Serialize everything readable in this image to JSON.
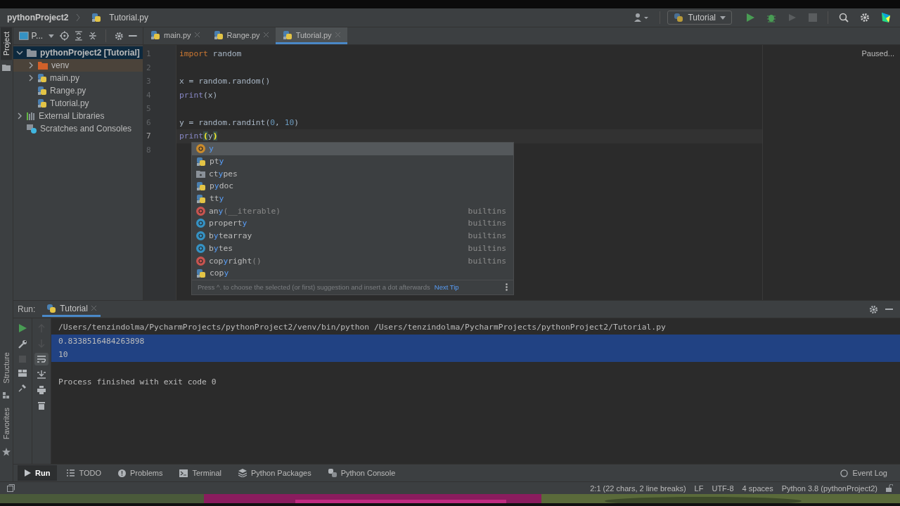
{
  "nav_bar": {
    "breadcrumbs": [
      "pythonProject2",
      "Tutorial.py"
    ],
    "run_config": "Tutorial"
  },
  "project_panel": {
    "tool_label": "Project",
    "view_label": "P...",
    "tree": [
      {
        "label": "pythonProject2 [Tutorial]",
        "kind": "project",
        "expanded": true,
        "selected": true,
        "children": [
          {
            "label": "venv",
            "kind": "excluded-folder",
            "expanded": false,
            "selected": true
          },
          {
            "label": "main.py",
            "kind": "python-file",
            "expanded": false,
            "selected": false
          },
          {
            "label": "Range.py",
            "kind": "python-file",
            "selected": false
          },
          {
            "label": "Tutorial.py",
            "kind": "python-file",
            "selected": false
          }
        ]
      },
      {
        "label": "External Libraries",
        "kind": "libraries",
        "expanded": false,
        "selected": false
      },
      {
        "label": "Scratches and Consoles",
        "kind": "scratches",
        "selected": false
      }
    ]
  },
  "editor_tabs": [
    {
      "label": "main.py",
      "selected": false
    },
    {
      "label": "Range.py",
      "selected": false
    },
    {
      "label": "Tutorial.py",
      "selected": true
    }
  ],
  "editor": {
    "status": "Paused...",
    "lines": [
      {
        "number": "1",
        "current": false,
        "tokens": [
          {
            "text": "import",
            "kind": "keyword"
          },
          {
            "text": " random",
            "kind": "plain"
          }
        ]
      },
      {
        "number": "2",
        "current": false
      },
      {
        "number": "3",
        "current": false,
        "tokens": [
          {
            "text": "x = random.random()",
            "kind": "plain"
          }
        ]
      },
      {
        "number": "4",
        "current": false,
        "tokens": [
          {
            "text": "print",
            "kind": "builtin"
          },
          {
            "text": "(x)",
            "kind": "plain"
          }
        ]
      },
      {
        "number": "5",
        "current": false
      },
      {
        "number": "6",
        "current": false,
        "tokens": [
          {
            "text": "y = random.randint(",
            "kind": "plain"
          },
          {
            "text": "0",
            "kind": "number"
          },
          {
            "text": ", ",
            "kind": "plain"
          },
          {
            "text": "10",
            "kind": "number"
          },
          {
            "text": ")",
            "kind": "plain"
          }
        ]
      },
      {
        "number": "7",
        "current": true,
        "tokens": [
          {
            "text": "print",
            "kind": "builtin"
          },
          {
            "text": "(",
            "kind": "brace-match"
          },
          {
            "text": "y",
            "kind": "plain"
          },
          {
            "text": ")",
            "kind": "brace-match"
          }
        ]
      },
      {
        "number": "8",
        "current": false
      }
    ]
  },
  "completion": {
    "hint": "Press ^. to choose the selected (or first) suggestion and insert a dot afterwards",
    "next_tip": "Next Tip",
    "items": [
      {
        "kind": "variable",
        "selected": true,
        "parts": [
          {
            "text": "y",
            "match": true
          }
        ]
      },
      {
        "kind": "module",
        "selected": false,
        "parts": [
          {
            "text": "pt",
            "match": false
          },
          {
            "text": "y",
            "match": true
          }
        ]
      },
      {
        "kind": "package",
        "selected": false,
        "parts": [
          {
            "text": "ct",
            "match": false
          },
          {
            "text": "y",
            "match": true
          },
          {
            "text": "pes",
            "match": false
          }
        ]
      },
      {
        "kind": "module",
        "selected": false,
        "parts": [
          {
            "text": "p",
            "match": false
          },
          {
            "text": "y",
            "match": true
          },
          {
            "text": "doc",
            "match": false
          }
        ]
      },
      {
        "kind": "module",
        "selected": false,
        "parts": [
          {
            "text": "tt",
            "match": false
          },
          {
            "text": "y",
            "match": true
          }
        ]
      },
      {
        "kind": "function",
        "selected": false,
        "parts": [
          {
            "text": "an",
            "match": false
          },
          {
            "text": "y",
            "match": true
          }
        ],
        "args": "(__iterable)",
        "source": "builtins"
      },
      {
        "kind": "class",
        "selected": false,
        "parts": [
          {
            "text": "propert",
            "match": false
          },
          {
            "text": "y",
            "match": true
          }
        ],
        "source": "builtins"
      },
      {
        "kind": "class",
        "selected": false,
        "parts": [
          {
            "text": "b",
            "match": false
          },
          {
            "text": "y",
            "match": true
          },
          {
            "text": "tearray",
            "match": false
          }
        ],
        "source": "builtins"
      },
      {
        "kind": "class",
        "selected": false,
        "parts": [
          {
            "text": "b",
            "match": false
          },
          {
            "text": "y",
            "match": true
          },
          {
            "text": "tes",
            "match": false
          }
        ],
        "source": "builtins"
      },
      {
        "kind": "function",
        "selected": false,
        "parts": [
          {
            "text": "cop",
            "match": false
          },
          {
            "text": "y",
            "match": true
          },
          {
            "text": "right",
            "match": false
          }
        ],
        "args": "()",
        "source": "builtins"
      },
      {
        "kind": "module",
        "selected": false,
        "parts": [
          {
            "text": "cop",
            "match": false
          },
          {
            "text": "y",
            "match": true
          }
        ]
      }
    ]
  },
  "run_panel": {
    "label": "Run:",
    "tab": "Tutorial",
    "lines": [
      {
        "text": "/Users/tenzindolma/PycharmProjects/pythonProject2/venv/bin/python /Users/tenzindolma/PycharmProjects/pythonProject2/Tutorial.py",
        "kind": "command",
        "selected": false
      },
      {
        "text": "0.8338516484263898",
        "kind": "output",
        "selected": true
      },
      {
        "text": "10",
        "kind": "output",
        "selected": true
      },
      {
        "text": "Process finished with exit code 0",
        "kind": "status",
        "selected": false
      }
    ]
  },
  "side_tools": [
    "Structure",
    "Favorites"
  ],
  "bottom_tabs": [
    {
      "label": "Run",
      "kind": "run",
      "selected": true
    },
    {
      "label": "TODO",
      "kind": "todo",
      "selected": false
    },
    {
      "label": "Problems",
      "kind": "problems",
      "selected": false
    },
    {
      "label": "Terminal",
      "kind": "terminal",
      "selected": false
    },
    {
      "label": "Python Packages",
      "kind": "packages",
      "selected": false
    },
    {
      "label": "Python Console",
      "kind": "console",
      "selected": false
    }
  ],
  "event_log": "Event Log",
  "status_bar": [
    "2:1 (22 chars, 2 line breaks)",
    "LF",
    "UTF-8",
    "4 spaces",
    "Python 3.8 (pythonProject2)"
  ]
}
